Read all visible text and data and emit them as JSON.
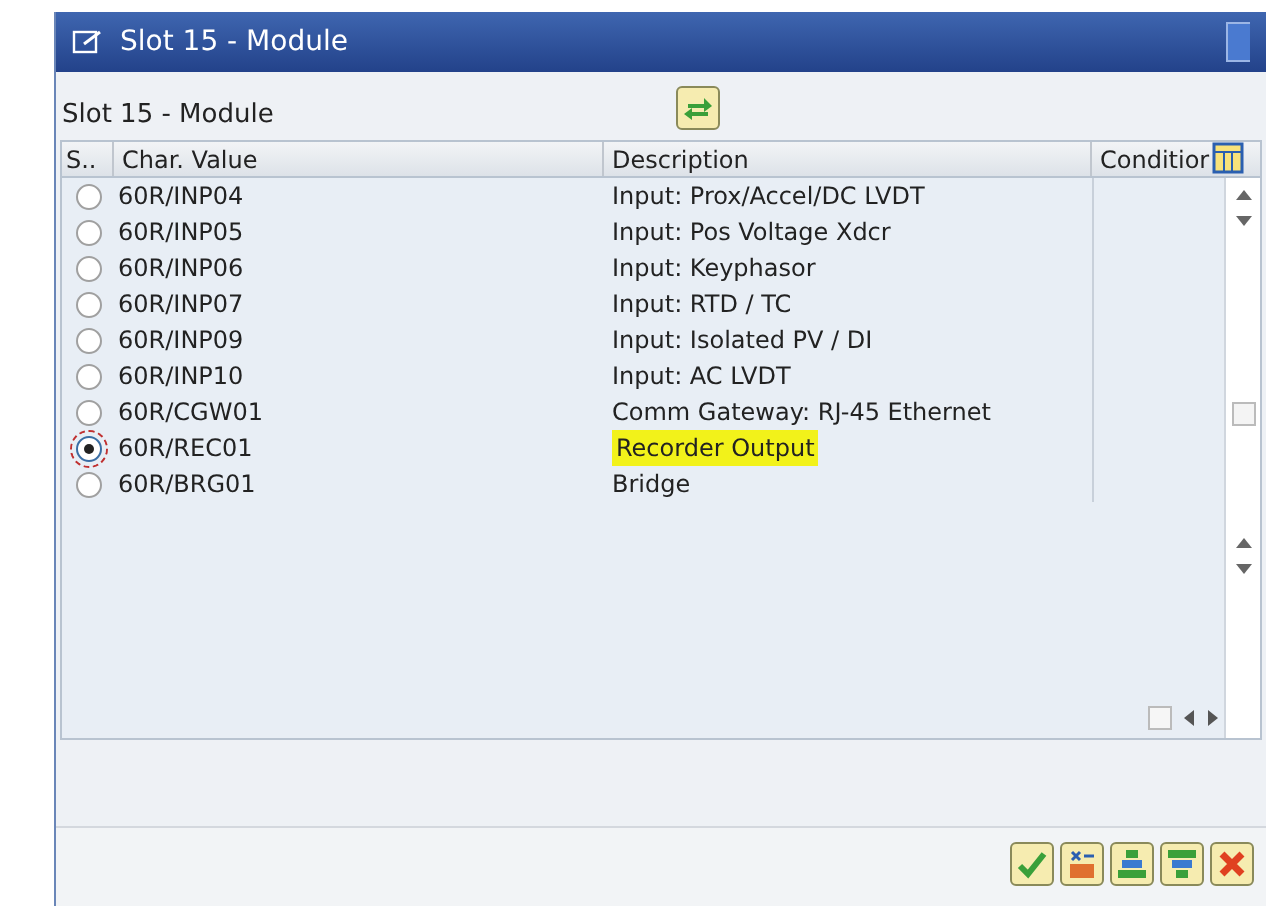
{
  "window": {
    "title": "Slot 15 - Module"
  },
  "panel_title": "Slot 15 - Module",
  "table": {
    "columns": [
      "S..",
      "Char. Value",
      "Description",
      "Conditior"
    ],
    "rows": [
      {
        "value": "60R/INP04",
        "description": "Input: Prox/Accel/DC LVDT",
        "selected": false,
        "highlighted": false
      },
      {
        "value": "60R/INP05",
        "description": "Input: Pos Voltage Xdcr",
        "selected": false,
        "highlighted": false
      },
      {
        "value": "60R/INP06",
        "description": "Input: Keyphasor",
        "selected": false,
        "highlighted": false
      },
      {
        "value": "60R/INP07",
        "description": "Input: RTD / TC",
        "selected": false,
        "highlighted": false
      },
      {
        "value": "60R/INP09",
        "description": "Input: Isolated PV / DI",
        "selected": false,
        "highlighted": false
      },
      {
        "value": "60R/INP10",
        "description": "Input: AC LVDT",
        "selected": false,
        "highlighted": false
      },
      {
        "value": "60R/CGW01",
        "description": "Comm Gateway: RJ-45 Ethernet",
        "selected": false,
        "highlighted": false
      },
      {
        "value": "60R/REC01",
        "description": "Recorder Output",
        "selected": true,
        "highlighted": true
      },
      {
        "value": "60R/BRG01",
        "description": "Bridge",
        "selected": false,
        "highlighted": false
      }
    ]
  }
}
